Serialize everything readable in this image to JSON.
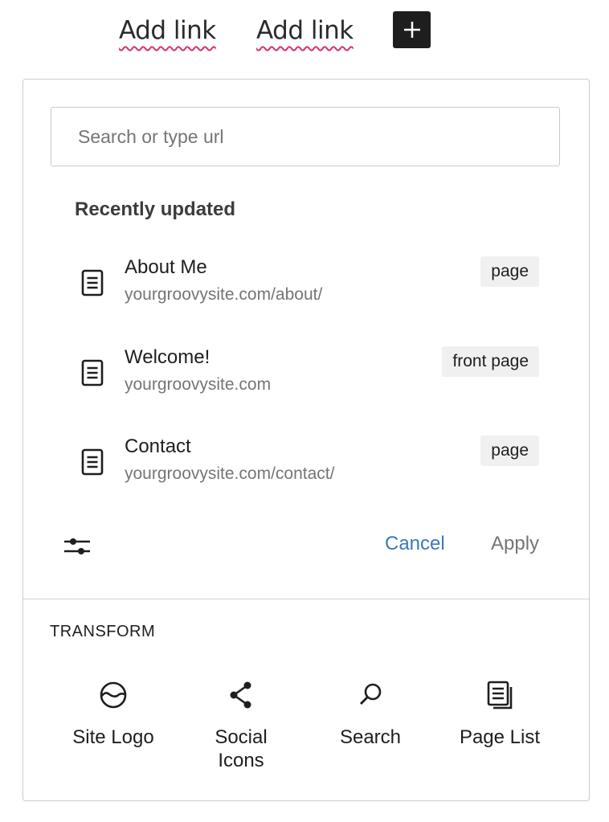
{
  "nav": {
    "links": [
      "Add link",
      "Add link"
    ],
    "add_block_symbol": "+"
  },
  "search": {
    "placeholder": "Search or type url"
  },
  "recent": {
    "title": "Recently updated",
    "items": [
      {
        "title": "About Me",
        "url": "yourgroovysite.com/about/",
        "type": "page",
        "icon": "page-icon"
      },
      {
        "title": "Welcome!",
        "url": "yourgroovysite.com",
        "type": "front page",
        "icon": "page-icon"
      },
      {
        "title": "Contact",
        "url": "yourgroovysite.com/contact/",
        "type": "page",
        "icon": "page-icon"
      }
    ]
  },
  "actions": {
    "cancel": "Cancel",
    "apply": "Apply"
  },
  "transform": {
    "title": "TRANSFORM",
    "items": [
      {
        "label": "Site Logo",
        "icon": "site-logo-icon"
      },
      {
        "label": "Social Icons",
        "icon": "share-icon"
      },
      {
        "label": "Search",
        "icon": "search-icon"
      },
      {
        "label": "Page List",
        "icon": "page-list-icon"
      }
    ]
  },
  "colors": {
    "accent": "#3b78c0",
    "dark": "#1e1e1e",
    "muted": "#757575",
    "badge_bg": "#f0f0f0"
  }
}
